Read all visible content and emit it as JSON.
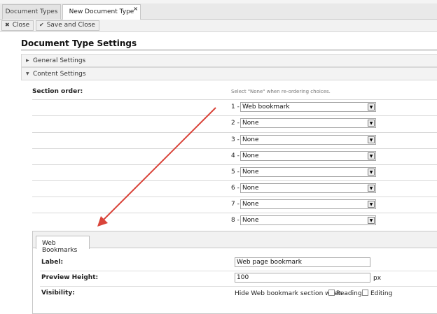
{
  "tabs": [
    {
      "label": "Document Types",
      "active": false
    },
    {
      "label": "New Document Type",
      "active": true,
      "close_glyph": "×"
    }
  ],
  "toolbar": {
    "close_label": "Close",
    "close_icon": "close-icon",
    "save_close_label": "Save and Close",
    "save_close_icon": "checkmark-icon"
  },
  "page_title": "Document Type Settings",
  "sections": {
    "general": {
      "label": "General Settings",
      "expanded": false
    },
    "content": {
      "label": "Content Settings",
      "expanded": true
    }
  },
  "section_order": {
    "label": "Section order:",
    "hint": "Select \"None\" when re-ordering choices.",
    "rows": [
      {
        "num": "1 -",
        "value": "Web bookmark"
      },
      {
        "num": "2 -",
        "value": "None"
      },
      {
        "num": "3 -",
        "value": "None"
      },
      {
        "num": "4 -",
        "value": "None"
      },
      {
        "num": "5 -",
        "value": "None"
      },
      {
        "num": "6 -",
        "value": "None"
      },
      {
        "num": "7 -",
        "value": "None"
      },
      {
        "num": "8 -",
        "value": "None"
      }
    ]
  },
  "web_bookmarks": {
    "tab_label": "Web Bookmarks",
    "label_field": {
      "label": "Label:",
      "value": "Web page bookmark"
    },
    "preview_height": {
      "label": "Preview Height:",
      "value": "100",
      "unit": "px"
    },
    "visibility": {
      "label": "Visibility:",
      "text": "Hide Web bookmark section when",
      "reading_label": "Reading",
      "reading_checked": false,
      "editing_label": "Editing",
      "editing_checked": false
    }
  },
  "annotation_color": "#d9443a"
}
